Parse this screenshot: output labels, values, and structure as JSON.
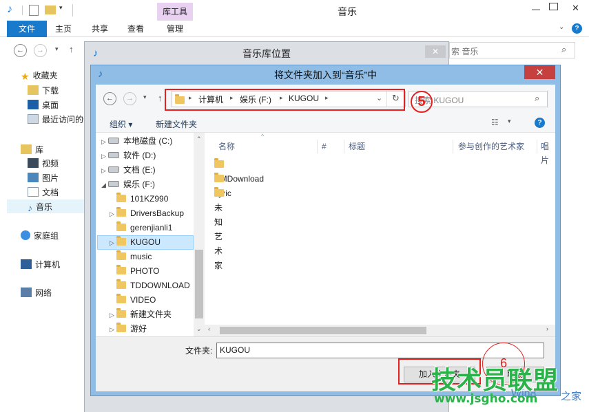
{
  "background_window": {
    "title": "音乐",
    "ribbon_tabs": [
      "文件",
      "主页",
      "共享",
      "查看",
      "管理"
    ],
    "context_tab_header": "库工具",
    "search_placeholder": "索 音乐",
    "nav": {
      "favorites": "收藏夹",
      "downloads": "下载",
      "desktop": "桌面",
      "recent": "最近访问的位",
      "libraries": "库",
      "videos": "视频",
      "pictures": "图片",
      "documents": "文档",
      "music": "音乐",
      "homegroup": "家庭组",
      "computer": "计算机",
      "network": "网络"
    }
  },
  "middle_dialog": {
    "title": "音乐库位置",
    "close_glyph": "✕"
  },
  "dialog": {
    "title": "将文件夹加入到“音乐”中",
    "close_glyph": "✕",
    "breadcrumb": [
      "计算机",
      "娱乐 (F:)",
      "KUGOU"
    ],
    "search_placeholder": "搜索 KUGOU",
    "toolbar": {
      "organize": "组织 ▾",
      "new_folder": "新建文件夹"
    },
    "tree": [
      {
        "label": "本地磁盘 (C:)",
        "type": "drive",
        "expander": "▷"
      },
      {
        "label": "软件 (D:)",
        "type": "drive",
        "expander": "▷"
      },
      {
        "label": "文档 (E:)",
        "type": "drive",
        "expander": "▷"
      },
      {
        "label": "娱乐 (F:)",
        "type": "drive",
        "expander": "◢"
      },
      {
        "label": "101KZ990",
        "type": "folder",
        "expander": ""
      },
      {
        "label": "DriversBackup",
        "type": "folder",
        "expander": "▷"
      },
      {
        "label": "gerenjianli1",
        "type": "folder",
        "expander": ""
      },
      {
        "label": "KUGOU",
        "type": "folder",
        "expander": "▷",
        "selected": true
      },
      {
        "label": "music",
        "type": "folder",
        "expander": ""
      },
      {
        "label": "PHOTO",
        "type": "folder",
        "expander": ""
      },
      {
        "label": "TDDOWNLOAD",
        "type": "folder",
        "expander": ""
      },
      {
        "label": "VIDEO",
        "type": "folder",
        "expander": ""
      },
      {
        "label": "新建文件夹",
        "type": "folder",
        "expander": "▷"
      },
      {
        "label": "游好",
        "type": "folder",
        "expander": "▷"
      }
    ],
    "columns": [
      "名称",
      "#",
      "标题",
      "参与创作的艺术家",
      "唱片"
    ],
    "files": [
      "DMDownload",
      "Lyric",
      "未知艺术家"
    ],
    "folder_label": "文件夹:",
    "folder_value": "KUGOU",
    "add_button": "加入文件夹",
    "cancel_button": "取消"
  },
  "annotations": {
    "step5": "5",
    "step6": "6"
  },
  "watermark": {
    "big": "技术员联盟",
    "url": "www.jsgho.com",
    "side": "之家",
    "win_text": "Win8"
  },
  "colors": {
    "accent": "#1979ca",
    "highlight": "#e42121",
    "watermark": "#2bb24a"
  }
}
